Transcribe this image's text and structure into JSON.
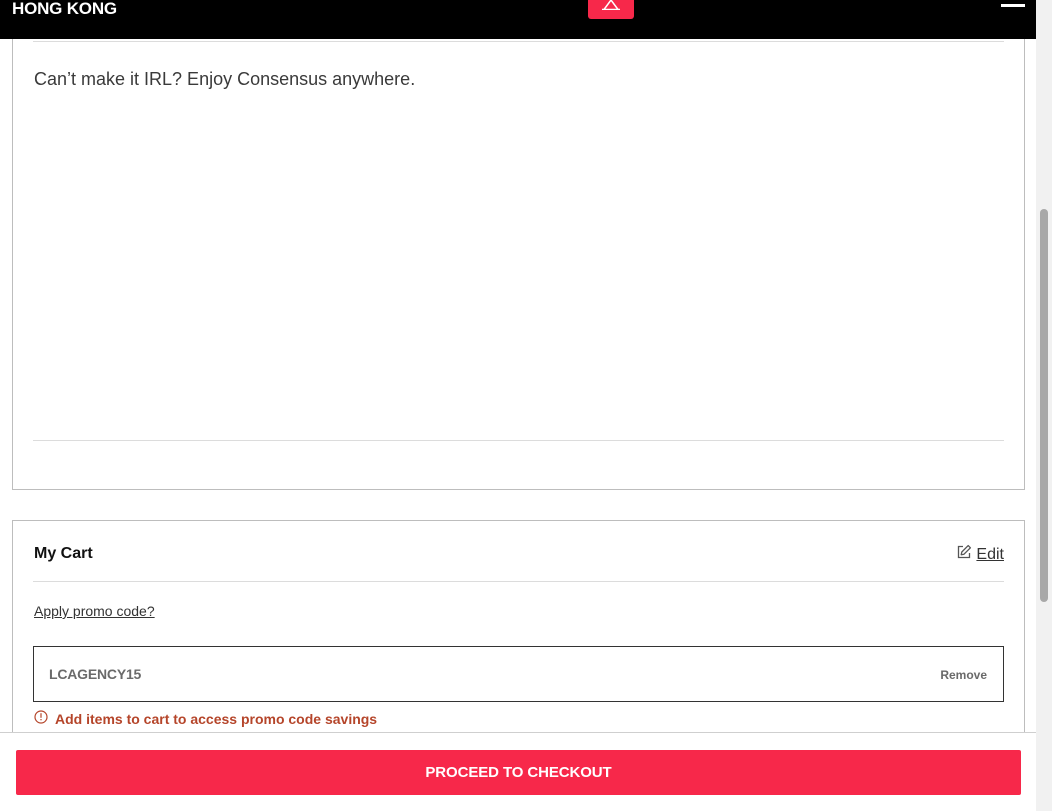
{
  "header": {
    "brand": "HONG KONG",
    "center_icon": "alert-icon",
    "menu_icon": "menu-icon"
  },
  "virtual_section": {
    "tagline": "Can’t make it IRL? Enjoy Consensus anywhere."
  },
  "cart": {
    "title": "My Cart",
    "edit_label": "Edit",
    "edit_icon": "edit-icon",
    "promo_link": "Apply promo code?",
    "promo_code": "LCAGENCY15",
    "remove_label": "Remove",
    "error_icon": "alert-circle-icon",
    "error_message": "Add items to cart to access promo code savings"
  },
  "checkout": {
    "button_label": "PROCEED TO CHECKOUT"
  },
  "colors": {
    "accent": "#f7284a",
    "error": "#b5452a",
    "header_bg": "#000000"
  }
}
